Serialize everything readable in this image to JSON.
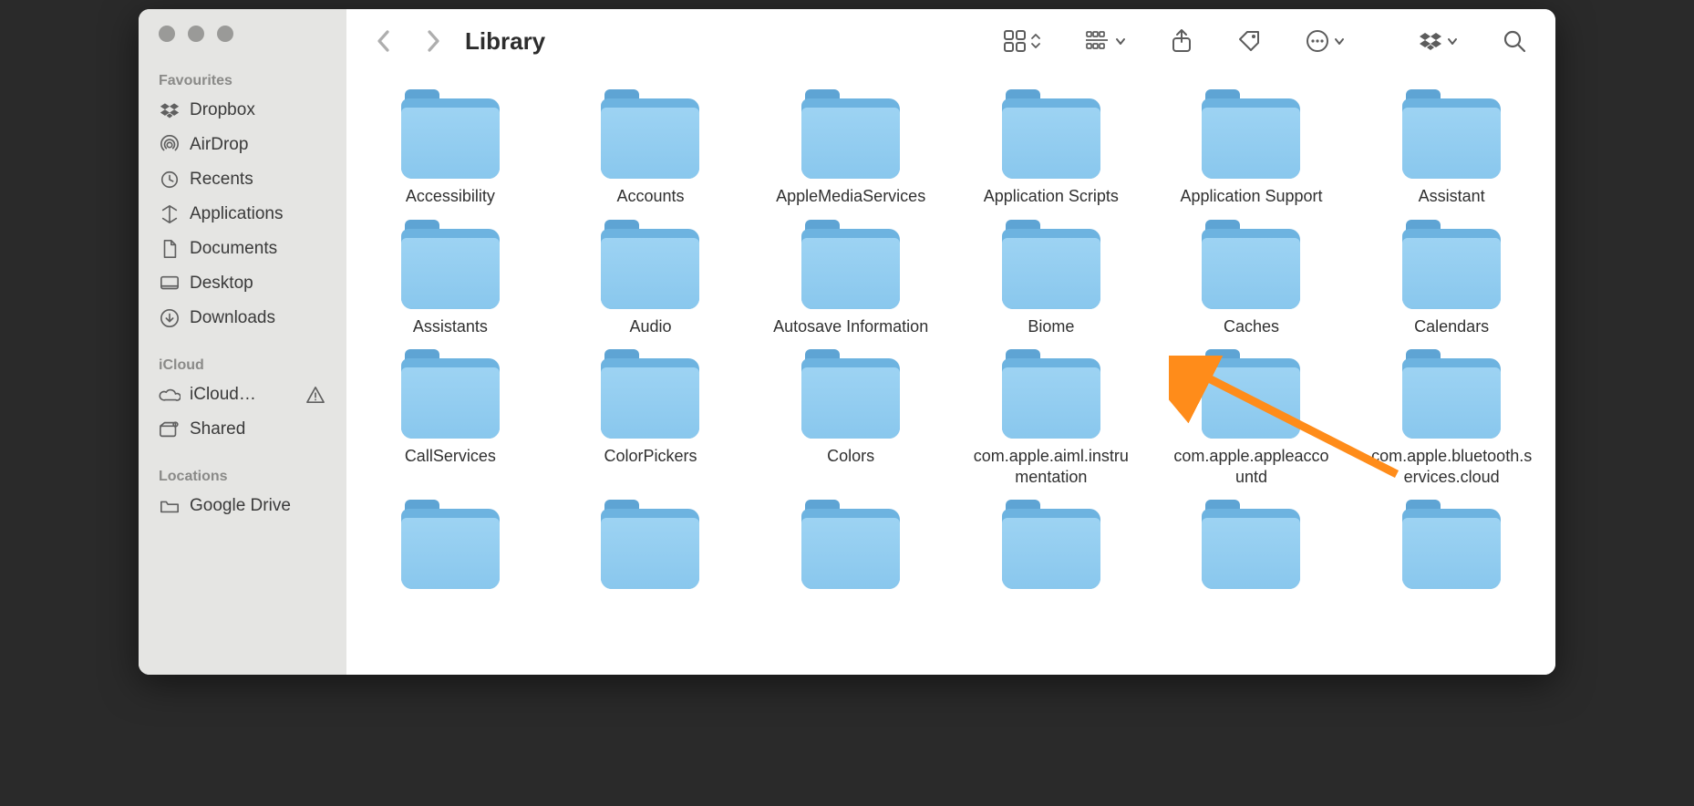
{
  "window_title": "Library",
  "sidebar": {
    "sections": [
      {
        "header": "Favourites",
        "items": [
          {
            "label": "Dropbox",
            "icon": "dropbox"
          },
          {
            "label": "AirDrop",
            "icon": "airdrop"
          },
          {
            "label": "Recents",
            "icon": "clock"
          },
          {
            "label": "Applications",
            "icon": "apps"
          },
          {
            "label": "Documents",
            "icon": "doc"
          },
          {
            "label": "Desktop",
            "icon": "desktop"
          },
          {
            "label": "Downloads",
            "icon": "download"
          }
        ]
      },
      {
        "header": "iCloud",
        "items": [
          {
            "label": "iCloud…",
            "icon": "cloud",
            "warning": true
          },
          {
            "label": "Shared",
            "icon": "shared"
          }
        ]
      },
      {
        "header": "Locations",
        "items": [
          {
            "label": "Google Drive",
            "icon": "folder-gen"
          }
        ]
      }
    ]
  },
  "folders": [
    "Accessibility",
    "Accounts",
    "AppleMediaServices",
    "Application Scripts",
    "Application Support",
    "Assistant",
    "Assistants",
    "Audio",
    "Autosave Information",
    "Biome",
    "Caches",
    "Calendars",
    "CallServices",
    "ColorPickers",
    "Colors",
    "com.apple.aiml.instrumentation",
    "com.apple.appleaccountd",
    "com.apple.bluetooth.services.cloud"
  ],
  "toolbar_icons": [
    "icons-view",
    "group-view",
    "share",
    "tag",
    "more",
    "dropbox-tool",
    "search"
  ]
}
